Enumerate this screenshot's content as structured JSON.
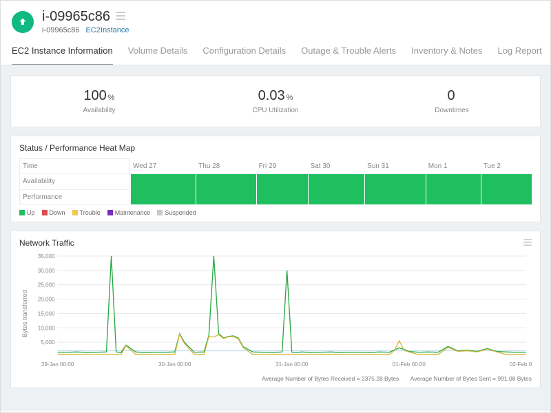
{
  "header": {
    "title": "i-09965c86",
    "breadcrumb_name": "i-09965c86",
    "breadcrumb_type": "EC2Instance"
  },
  "tabs": [
    {
      "label": "EC2 Instance Information",
      "active": true
    },
    {
      "label": "Volume Details"
    },
    {
      "label": "Configuration Details"
    },
    {
      "label": "Outage & Trouble Alerts"
    },
    {
      "label": "Inventory & Notes"
    },
    {
      "label": "Log Report"
    }
  ],
  "stats": {
    "availability": {
      "value": "100",
      "unit": "%",
      "label": "Availability"
    },
    "cpu": {
      "value": "0.03",
      "unit": "%",
      "label": "CPU Utilization"
    },
    "downtimes": {
      "value": "0",
      "unit": "",
      "label": "Downtimes"
    }
  },
  "heatmap": {
    "title": "Status / Performance Heat Map",
    "time_label": "Time",
    "days": [
      "Wed 27",
      "Thu 28",
      "Fri 29",
      "Sat 30",
      "Sun 31",
      "Mon 1",
      "Tue 2"
    ],
    "rows": [
      "Availability",
      "Performance"
    ],
    "legend": [
      {
        "label": "Up",
        "color": "#1fbf5f"
      },
      {
        "label": "Down",
        "color": "#e04b4b"
      },
      {
        "label": "Trouble",
        "color": "#f2c94c"
      },
      {
        "label": "Maintenance",
        "color": "#7b2cbf"
      },
      {
        "label": "Suspended",
        "color": "#c9c9c9"
      }
    ]
  },
  "network": {
    "title": "Network Traffic",
    "ylabel": "Bytes transferred",
    "avg_recv": "Average Number of Bytes Received = 2375.28 Bytes",
    "avg_sent": "Average Number of Bytes Sent = 991.08 Bytes"
  },
  "chart_data": {
    "type": "line",
    "xlabel": "",
    "title": "Network Traffic",
    "ylabel": "Bytes transferred",
    "ylim": [
      0,
      35000
    ],
    "y_ticks": [
      5000,
      10000,
      15000,
      20000,
      25000,
      30000,
      35000
    ],
    "x_categories": [
      "29-Jan 00:00",
      "30-Jan 00:00",
      "31-Jan 00:00",
      "01-Feb 00:00",
      "02-Feb 00:00"
    ],
    "x": [
      0,
      2,
      4,
      6,
      8,
      10,
      11,
      12,
      13,
      14,
      16,
      18,
      20,
      22,
      24,
      25,
      26,
      28,
      30,
      31,
      32,
      33,
      34,
      35,
      36,
      37,
      38,
      40,
      42,
      44,
      46,
      47,
      48,
      49,
      50,
      52,
      54,
      56,
      58,
      60,
      62,
      64,
      66,
      68,
      69,
      70,
      71,
      72,
      74,
      76,
      78,
      80,
      82,
      84,
      86,
      88,
      90,
      92,
      94,
      96
    ],
    "series": [
      {
        "name": "Bytes Received",
        "color": "#28a745",
        "values": [
          1500,
          1500,
          1600,
          1400,
          1500,
          1600,
          35000,
          1600,
          1400,
          4000,
          1600,
          1400,
          1500,
          1500,
          1600,
          8000,
          5000,
          1500,
          1600,
          7500,
          35000,
          8000,
          6500,
          7000,
          7200,
          6500,
          3500,
          1600,
          1500,
          1400,
          1600,
          30000,
          1500,
          1400,
          1600,
          1400,
          1500,
          1600,
          1400,
          1500,
          1500,
          1400,
          1600,
          1500,
          2300,
          3000,
          2500,
          1800,
          1500,
          1600,
          1500,
          3500,
          2000,
          2200,
          1800,
          2800,
          1800,
          1600,
          1500,
          1500
        ]
      },
      {
        "name": "Bytes Sent",
        "color": "#d6b63a",
        "values": [
          700,
          700,
          700,
          700,
          750,
          700,
          800,
          700,
          700,
          3800,
          700,
          700,
          700,
          700,
          700,
          7800,
          4500,
          700,
          700,
          7000,
          6800,
          7600,
          6300,
          6900,
          7000,
          6200,
          3200,
          700,
          700,
          700,
          700,
          800,
          700,
          700,
          700,
          700,
          800,
          700,
          700,
          700,
          700,
          700,
          700,
          700,
          2100,
          5500,
          2200,
          1600,
          700,
          700,
          700,
          3200,
          1800,
          2000,
          1600,
          2600,
          1600,
          700,
          700,
          700
        ]
      }
    ]
  }
}
